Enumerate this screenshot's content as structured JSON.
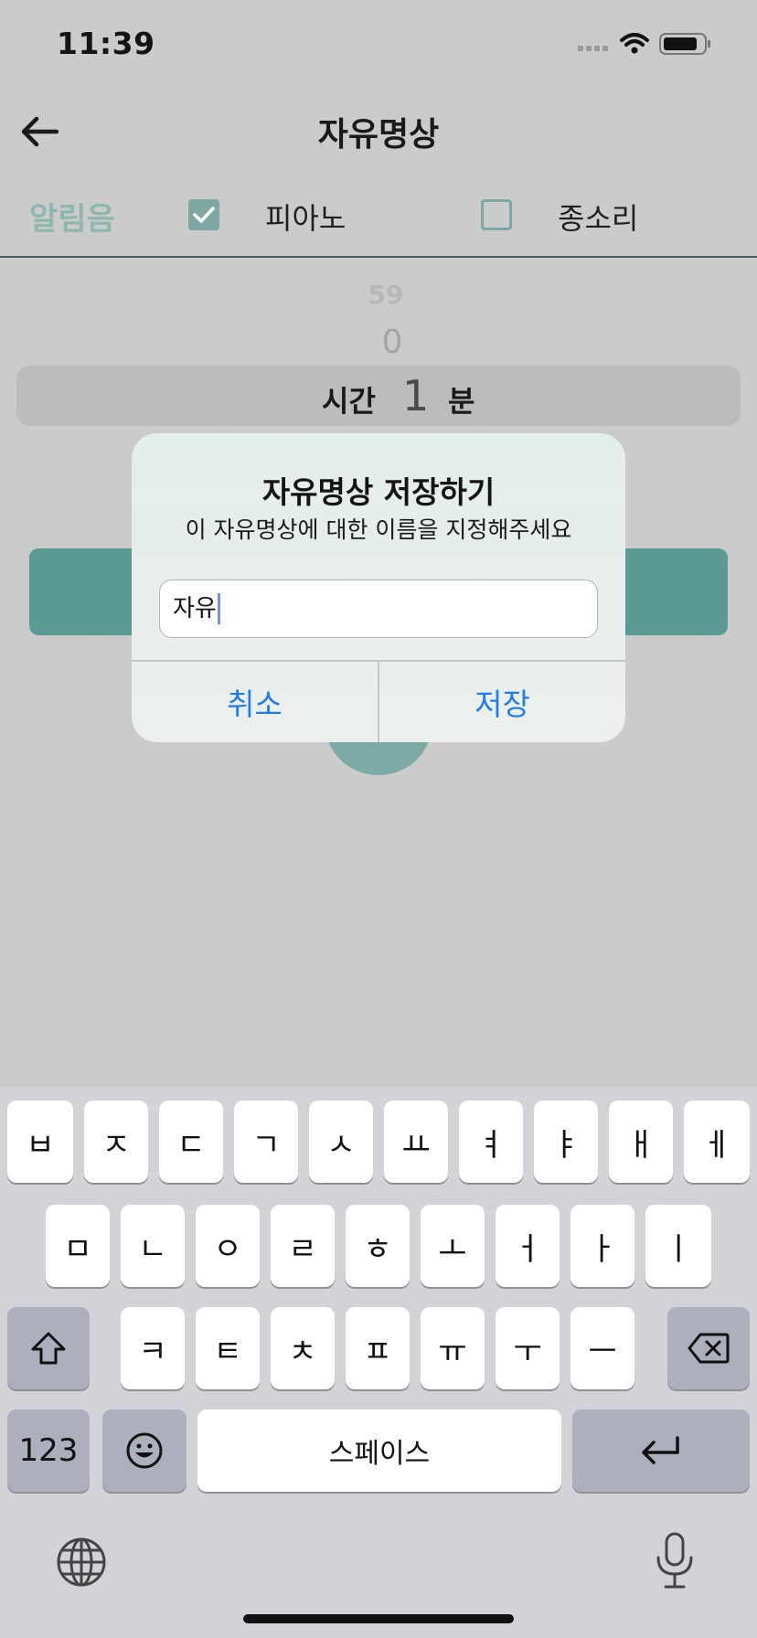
{
  "status_bar": {
    "time": "11:39"
  },
  "nav": {
    "title": "자유명상"
  },
  "sound": {
    "label": "알림음",
    "options": [
      {
        "label": "피아노",
        "checked": true
      },
      {
        "label": "종소리",
        "checked": false
      }
    ]
  },
  "picker": {
    "above2": "59",
    "above1": "0",
    "label": "시간",
    "value": "1",
    "unit": "분"
  },
  "dialog": {
    "title": "자유명상 저장하기",
    "message": "이 자유명상에 대한 이름을 지정해주세요",
    "input_value": "자유",
    "cancel_label": "취소",
    "save_label": "저장"
  },
  "keyboard": {
    "row1": [
      "ㅂ",
      "ㅈ",
      "ㄷ",
      "ㄱ",
      "ㅅ",
      "ㅛ",
      "ㅕ",
      "ㅑ",
      "ㅐ",
      "ㅔ"
    ],
    "row2": [
      "ㅁ",
      "ㄴ",
      "ㅇ",
      "ㄹ",
      "ㅎ",
      "ㅗ",
      "ㅓ",
      "ㅏ",
      "ㅣ"
    ],
    "row3": [
      "ㅋ",
      "ㅌ",
      "ㅊ",
      "ㅍ",
      "ㅠ",
      "ㅜ",
      "ㅡ"
    ],
    "numbers_label": "123",
    "space_label": "스페이스"
  },
  "colors": {
    "accent": "#5a9c94",
    "link": "#1e7de6"
  }
}
